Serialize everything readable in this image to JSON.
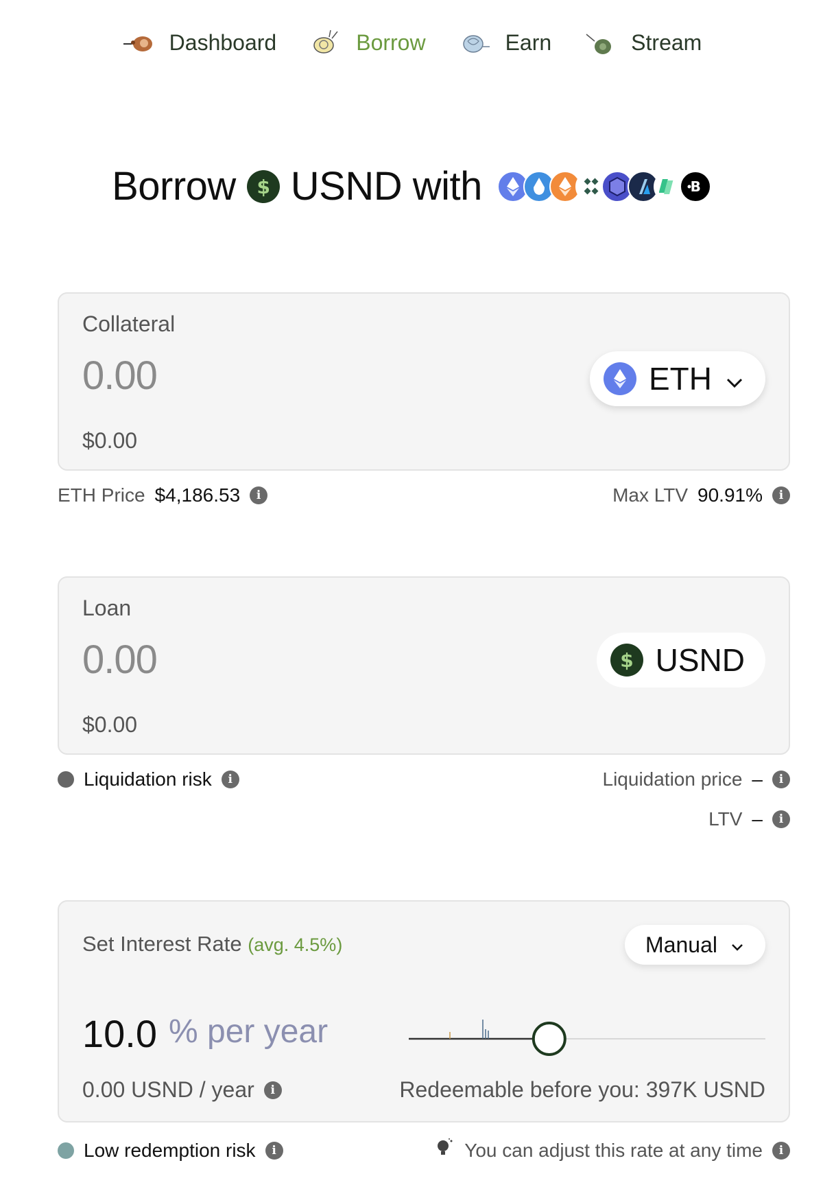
{
  "nav": {
    "items": [
      {
        "label": "Dashboard",
        "icon": "snail-dashboard-icon"
      },
      {
        "label": "Borrow",
        "icon": "snail-borrow-icon",
        "active": true
      },
      {
        "label": "Earn",
        "icon": "snail-earn-icon"
      },
      {
        "label": "Stream",
        "icon": "snail-stream-icon"
      }
    ]
  },
  "title": {
    "part1": "Borrow",
    "part2": "USND with",
    "collateral_icons": [
      "eth-icon",
      "steth-icon",
      "reth-icon",
      "cluster-icon",
      "shield-icon",
      "arbitrum-icon",
      "stack-icon",
      "b-icon"
    ]
  },
  "collateral": {
    "label": "Collateral",
    "amount": "0.00",
    "usd": "$0.00",
    "token": "ETH",
    "price_label": "ETH Price",
    "price_value": "$4,186.53",
    "max_ltv_label": "Max LTV",
    "max_ltv_value": "90.91%"
  },
  "loan": {
    "label": "Loan",
    "amount": "0.00",
    "usd": "$0.00",
    "token": "USND",
    "risk_label": "Liquidation risk",
    "liq_price_label": "Liquidation price",
    "liq_price_value": "–",
    "ltv_label": "LTV",
    "ltv_value": "–"
  },
  "interest": {
    "label": "Set Interest Rate",
    "avg": "(avg. 4.5%)",
    "mode": "Manual",
    "value": "10.0",
    "unit": "% per year",
    "yearly": "0.00 USND / year",
    "redeemable": "Redeemable before you: 397K USND",
    "slider_fraction": 0.385
  },
  "footer": {
    "redemption_risk": "Low redemption risk",
    "adjust_note": "You can adjust this rate at any time"
  },
  "colors": {
    "accent_green": "#6b9a3f",
    "usnd_dark": "#1e3a1f",
    "eth_purple": "#627eea",
    "redemption_dot": "#7ea3a3",
    "liquidation_dot": "#666666"
  }
}
